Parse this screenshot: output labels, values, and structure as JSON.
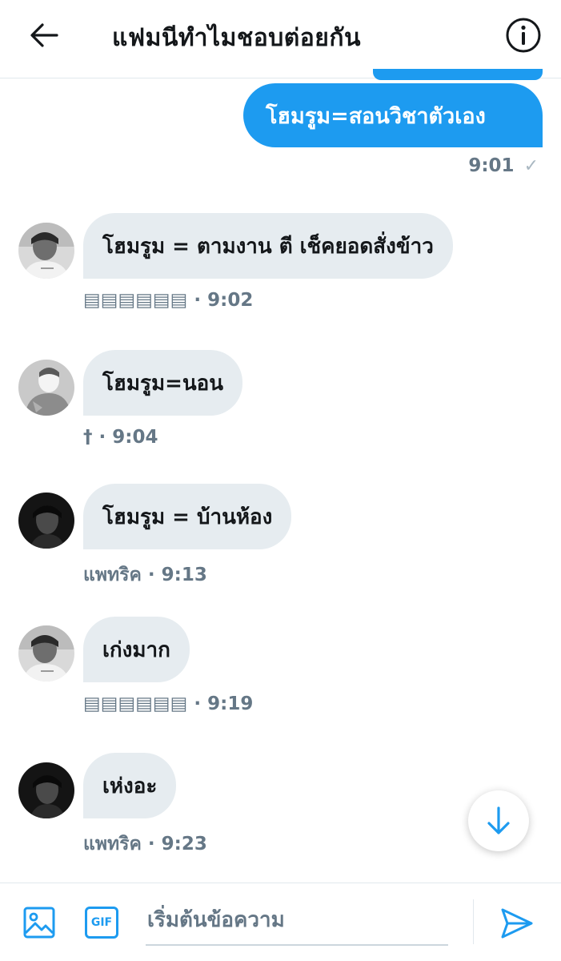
{
  "header": {
    "title": "แฟมนีทำไมชอบต่อยกัน",
    "back_icon": "arrow-left-icon",
    "info_icon": "info-circle-icon"
  },
  "messages": [
    {
      "direction": "out",
      "text": "โฮมรูม=สอนวิชาตัวเอง",
      "time": "9:01",
      "status_icon": "check-icon"
    },
    {
      "direction": "in",
      "text": "โฮมรูม = ตามงาน ตี เช็คยอดสั่งข้าว",
      "sender": "▤▤▤▤▤▤",
      "time": "9:02",
      "meta": "▤▤▤▤▤▤ · 9:02"
    },
    {
      "direction": "in",
      "text": "โฮมรูม=นอน",
      "sender": "†",
      "time": "9:04",
      "meta": "† · 9:04"
    },
    {
      "direction": "in",
      "text": "โฮมรูม = บ้านห้อง",
      "sender": "แพทริค",
      "time": "9:13",
      "meta": "แพทริค · 9:13"
    },
    {
      "direction": "in",
      "text": "เก่งมาก",
      "sender": "▤▤▤▤▤▤",
      "time": "9:19",
      "meta": "▤▤▤▤▤▤ · 9:19"
    },
    {
      "direction": "in",
      "text": "เห่งอะ",
      "sender": "แพทริค",
      "time": "9:23",
      "meta": "แพทริค · 9:23"
    }
  ],
  "composer": {
    "placeholder": "เริ่มต้นข้อความ",
    "gif_label": "GIF",
    "image_icon": "image-icon",
    "send_icon": "send-icon"
  },
  "scroll_down_icon": "arrow-down-icon",
  "colors": {
    "accent": "#1d9bf0",
    "incoming_bubble": "#e6ecf0",
    "meta_text": "#657786"
  }
}
